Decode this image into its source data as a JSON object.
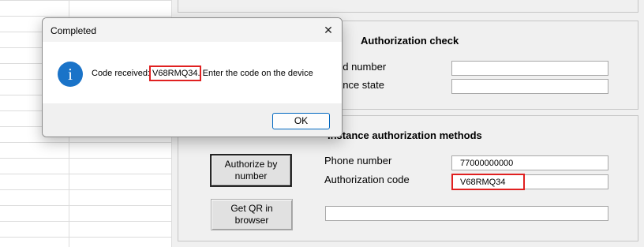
{
  "message_box": {
    "title": "Completed",
    "message_prefix": "Code received: ",
    "code": "V68RMQ34",
    "message_suffix": ". Enter the code on the device",
    "ok_label": "OK",
    "close_glyph": "✕",
    "icon_glyph": "i",
    "icon": "information-icon"
  },
  "authorization_check": {
    "title": "Authorization check",
    "field1_label": "ed number",
    "field1_value": "",
    "field2_label": "ance state",
    "field2_value": ""
  },
  "authorization_methods": {
    "title": "Instance authorization methods",
    "authorize_button": "Authorize by number",
    "qr_button": "Get QR in browser",
    "phone_label": "Phone number",
    "phone_value": "77000000000",
    "code_label": "Authorization code",
    "code_value": "V68RMQ34",
    "link_value": ""
  },
  "colors": {
    "highlight": "#e02020",
    "info_icon": "#1a73c8",
    "ok_border": "#0067c0"
  }
}
